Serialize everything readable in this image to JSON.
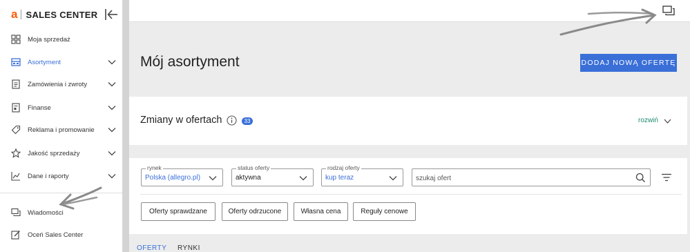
{
  "sidebar": {
    "logo_letter": "a",
    "logo_text": "SALES CENTER",
    "items": [
      {
        "label": "Moja sprzedaż",
        "icon": "grid-icon"
      },
      {
        "label": "Asortyment",
        "icon": "inventory-icon"
      },
      {
        "label": "Zamówienia i zwroty",
        "icon": "orders-icon"
      },
      {
        "label": "Finanse",
        "icon": "finance-icon"
      },
      {
        "label": "Reklama i promowanie",
        "icon": "tag-icon"
      },
      {
        "label": "Jakość sprzedaży",
        "icon": "star-icon"
      },
      {
        "label": "Dane i raporty",
        "icon": "chart-icon"
      },
      {
        "label": "Wiadomości",
        "icon": "messages-icon"
      },
      {
        "label": "Oceń Sales Center",
        "icon": "edit-icon"
      }
    ]
  },
  "main": {
    "title": "Mój asortyment",
    "add_offer_label": "DODAJ NOWĄ OFERTĘ",
    "changes": {
      "title": "Zmiany w ofertach",
      "count": "33",
      "expand_label": "rozwiń"
    },
    "filters": {
      "market": {
        "legend": "rynek",
        "value": "Polska (allegro.pl)"
      },
      "status": {
        "legend": "status oferty",
        "value": "aktywna"
      },
      "type": {
        "legend": "rodzaj oferty",
        "value": "kup teraz"
      },
      "search_placeholder": "szukaj ofert"
    },
    "chips": [
      "Oferty sprawdzane",
      "Oferty odrzucone",
      "Własna cena",
      "Reguły cenowe"
    ],
    "tabs": [
      "OFERTY",
      "RYNKI"
    ]
  },
  "colors": {
    "accent": "#3a6fd8",
    "brand": "#ff5a00",
    "link": "#1a8a6e"
  }
}
